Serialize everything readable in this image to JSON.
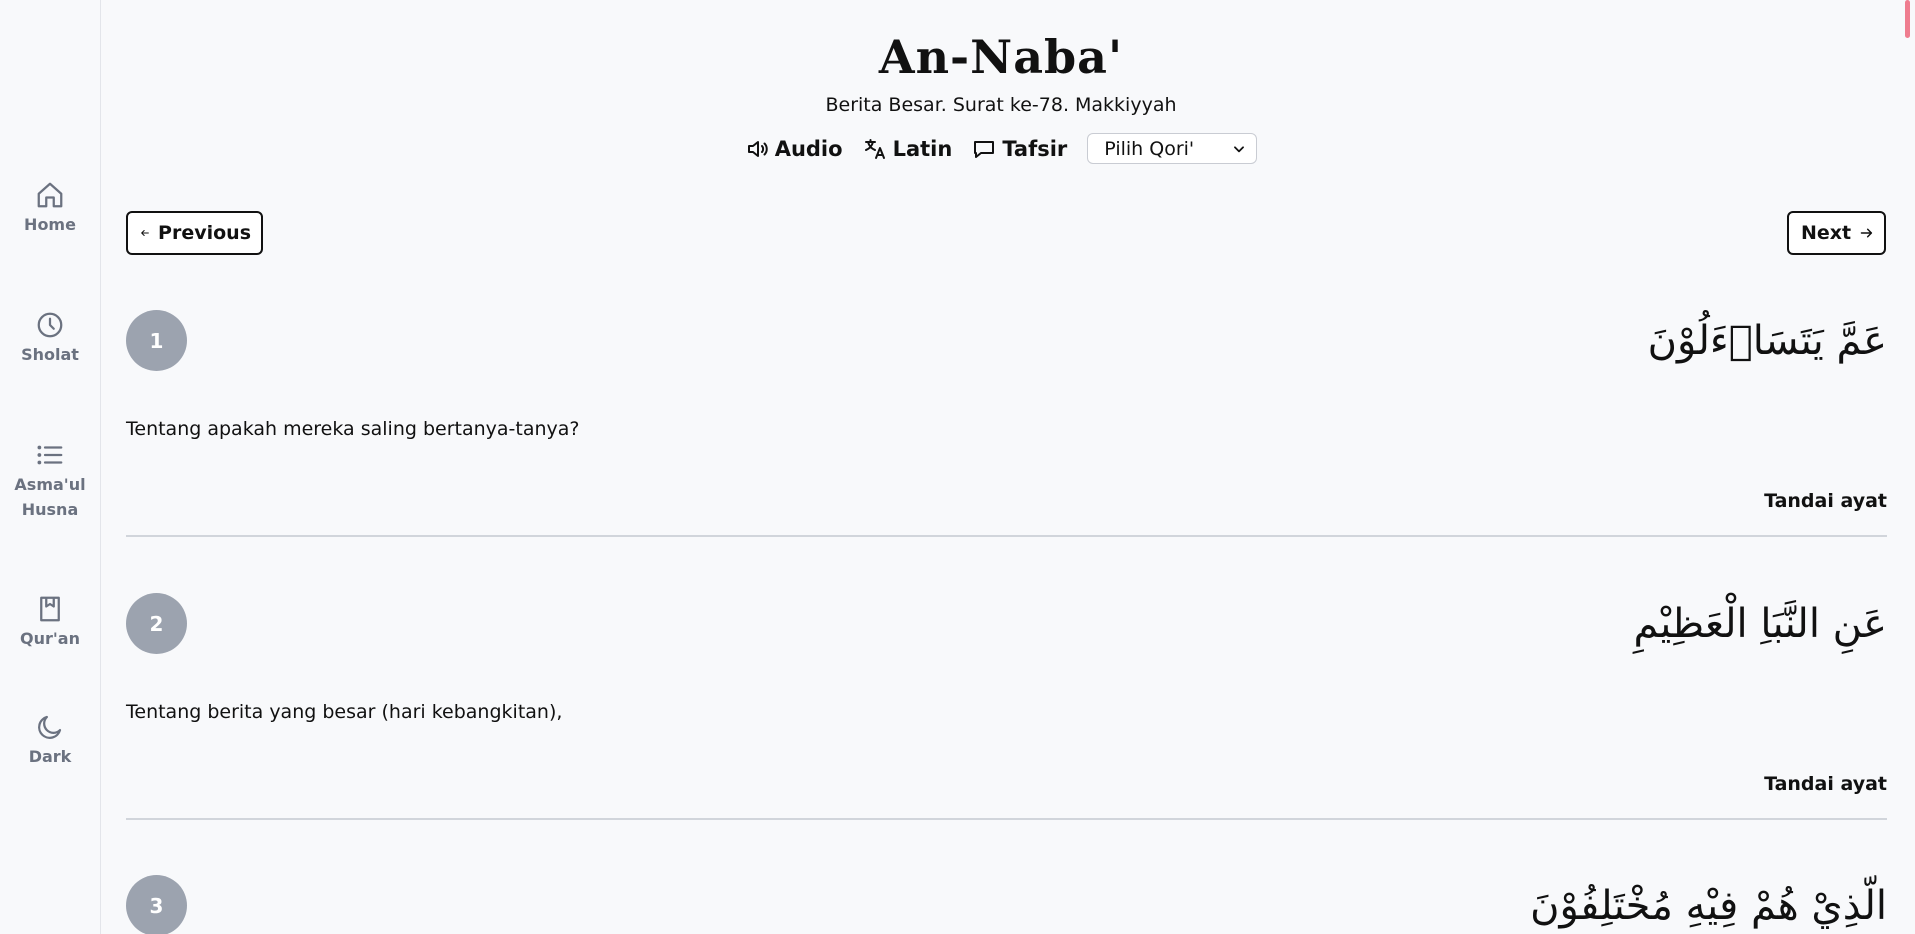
{
  "sidebar": {
    "items": [
      {
        "label": "Home",
        "icon": "home-icon"
      },
      {
        "label": "Sholat",
        "icon": "clock-icon"
      },
      {
        "label": "Asma'ul Husna",
        "icon": "list-icon"
      },
      {
        "label": "Qur'an",
        "icon": "book-icon"
      },
      {
        "label": "Dark",
        "icon": "moon-icon"
      }
    ]
  },
  "surah": {
    "title": "An-Naba'",
    "subtitle": "Berita Besar. Surat ke-78. Makkiyyah"
  },
  "toolbar": {
    "audio_label": "Audio",
    "latin_label": "Latin",
    "tafsir_label": "Tafsir",
    "qori_select": "Pilih Qori'"
  },
  "navigation": {
    "previous_label": "Previous",
    "next_label": "Next"
  },
  "ayahs": [
    {
      "number": "1",
      "arabic": "عَمَّ يَتَسَاۤءَلُوْنَ",
      "translation": "Tentang apakah mereka saling bertanya-tanya?",
      "mark_label": "Tandai ayat"
    },
    {
      "number": "2",
      "arabic": "عَنِ النَّبَاِ الْعَظِيْمِ",
      "translation": "Tentang berita yang besar (hari kebangkitan),",
      "mark_label": "Tandai ayat"
    },
    {
      "number": "3",
      "arabic": "الَّذِيْ هُمْ فِيْهِ مُخْتَلِفُوْنَ"
    }
  ],
  "colors": {
    "background": "#f8f9fb",
    "ayah_badge": "#9ca3af",
    "nav_text": "#6b7280",
    "scroll_accent": "#ef7d8f"
  }
}
